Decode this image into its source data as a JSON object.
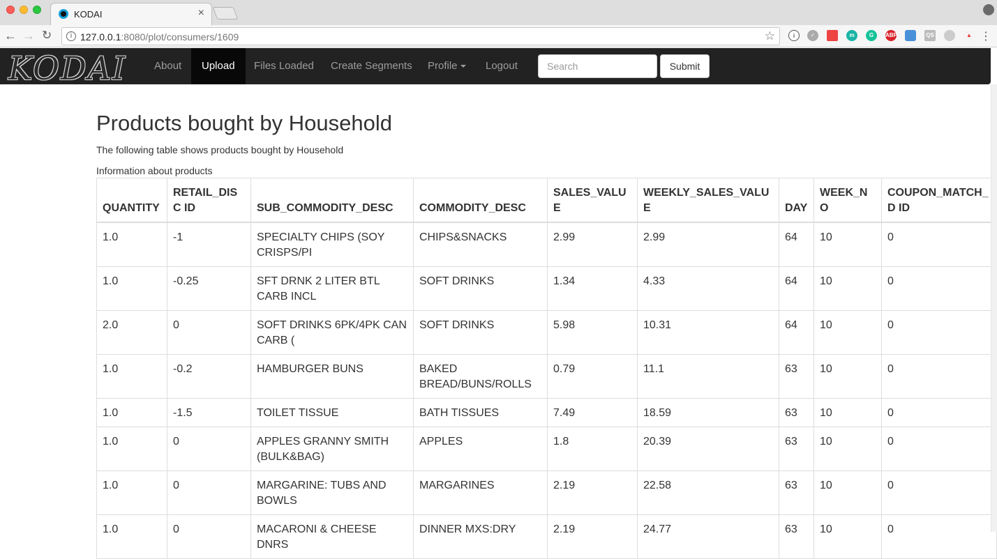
{
  "browser": {
    "tab_title": "KODAI",
    "url_host": "127.0.0.1",
    "url_rest": ":8080/plot/consumers/1609"
  },
  "navbar": {
    "brand": "KODAI",
    "links": [
      "About",
      "Upload",
      "Files Loaded",
      "Create Segments",
      "Profile",
      "Logout"
    ],
    "active": "Upload",
    "search_placeholder": "Search",
    "submit_label": "Submit"
  },
  "page": {
    "title": "Products bought by Household",
    "subtitle": "The following table shows products bought by Household",
    "caption": "Information about products"
  },
  "table": {
    "headers": [
      "QUANTITY",
      "RETAIL_DISC ID",
      "SUB_COMMODITY_DESC",
      "COMMODITY_DESC",
      "SALES_VALUE",
      "WEEKLY_SALES_VALUE",
      "DAY",
      "WEEK_NO",
      "COUPON_MATCH_D ID"
    ],
    "rows": [
      [
        "1.0",
        "-1",
        "SPECIALTY CHIPS (SOY CRISPS/PI",
        "CHIPS&SNACKS",
        "2.99",
        "2.99",
        "64",
        "10",
        "0"
      ],
      [
        "1.0",
        "-0.25",
        "SFT DRNK 2 LITER BTL CARB INCL",
        "SOFT DRINKS",
        "1.34",
        "4.33",
        "64",
        "10",
        "0"
      ],
      [
        "2.0",
        "0",
        "SOFT DRINKS 6PK/4PK CAN CARB (",
        "SOFT DRINKS",
        "5.98",
        "10.31",
        "64",
        "10",
        "0"
      ],
      [
        "1.0",
        "-0.2",
        "HAMBURGER BUNS",
        "BAKED BREAD/BUNS/ROLLS",
        "0.79",
        "11.1",
        "63",
        "10",
        "0"
      ],
      [
        "1.0",
        "-1.5",
        "TOILET TISSUE",
        "BATH TISSUES",
        "7.49",
        "18.59",
        "63",
        "10",
        "0"
      ],
      [
        "1.0",
        "0",
        "APPLES GRANNY SMITH (BULK&BAG)",
        "APPLES",
        "1.8",
        "20.39",
        "63",
        "10",
        "0"
      ],
      [
        "1.0",
        "0",
        "MARGARINE: TUBS AND BOWLS",
        "MARGARINES",
        "2.19",
        "22.58",
        "63",
        "10",
        "0"
      ],
      [
        "1.0",
        "0",
        "MACARONI & CHEESE DNRS",
        "DINNER MXS:DRY",
        "2.19",
        "24.77",
        "63",
        "10",
        "0"
      ]
    ]
  }
}
